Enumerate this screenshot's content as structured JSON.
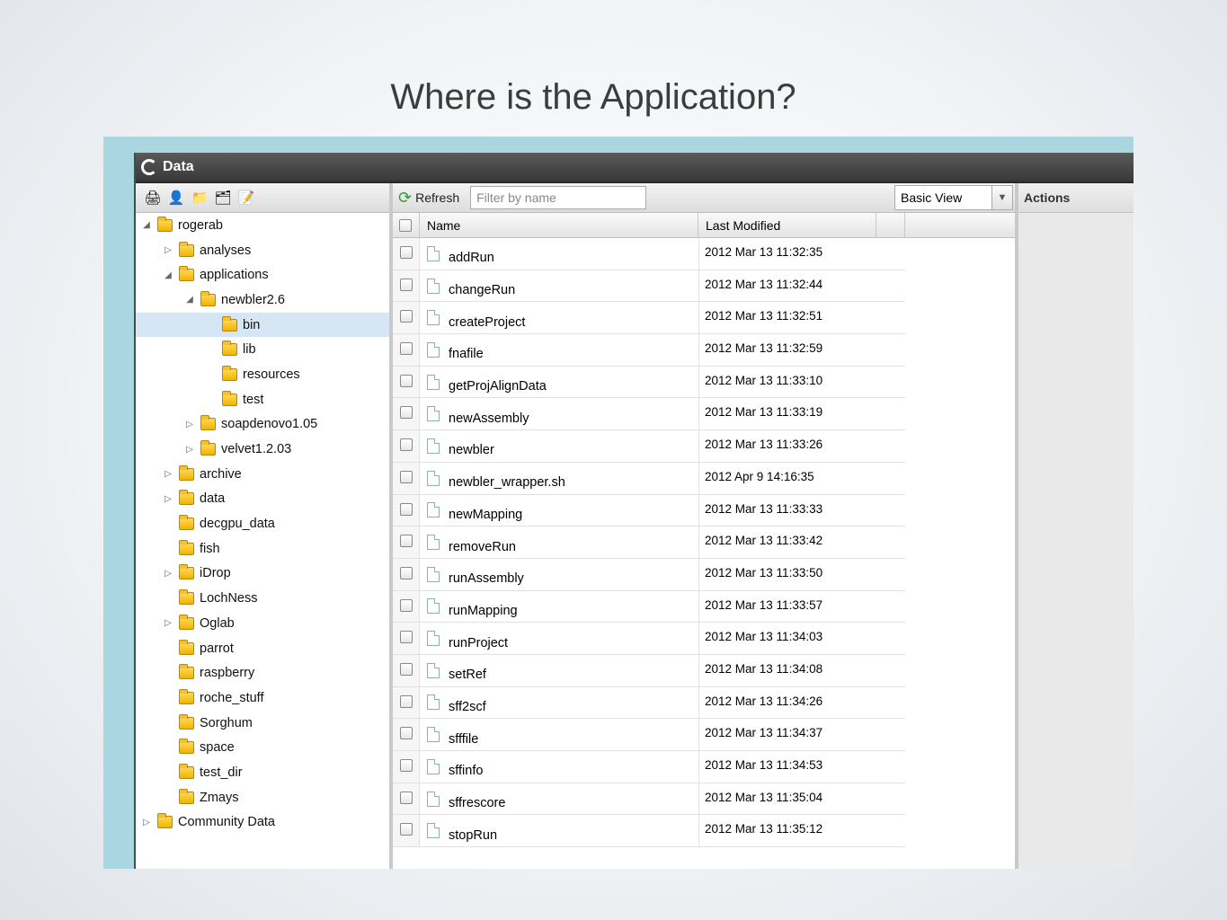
{
  "slide": {
    "title": "Where is the Application?"
  },
  "window": {
    "title": "Data"
  },
  "tree_toolbar": {
    "icons": [
      "upload-icon",
      "import-icon",
      "new-folder-icon",
      "delete-folder-icon",
      "edit-icon"
    ]
  },
  "tree": [
    {
      "label": "rogerab",
      "level": 0,
      "expander": "open"
    },
    {
      "label": "analyses",
      "level": 1,
      "expander": "closed"
    },
    {
      "label": "applications",
      "level": 1,
      "expander": "open"
    },
    {
      "label": "newbler2.6",
      "level": 2,
      "expander": "open"
    },
    {
      "label": "bin",
      "level": 3,
      "expander": "none",
      "selected": true
    },
    {
      "label": "lib",
      "level": 3,
      "expander": "none"
    },
    {
      "label": "resources",
      "level": 3,
      "expander": "none"
    },
    {
      "label": "test",
      "level": 3,
      "expander": "none"
    },
    {
      "label": "soapdenovo1.05",
      "level": 2,
      "expander": "closed"
    },
    {
      "label": "velvet1.2.03",
      "level": 2,
      "expander": "closed"
    },
    {
      "label": "archive",
      "level": 1,
      "expander": "closed"
    },
    {
      "label": "data",
      "level": 1,
      "expander": "closed"
    },
    {
      "label": "decgpu_data",
      "level": 1,
      "expander": "none"
    },
    {
      "label": "fish",
      "level": 1,
      "expander": "none"
    },
    {
      "label": "iDrop",
      "level": 1,
      "expander": "closed"
    },
    {
      "label": "LochNess",
      "level": 1,
      "expander": "none"
    },
    {
      "label": "Oglab",
      "level": 1,
      "expander": "closed"
    },
    {
      "label": "parrot",
      "level": 1,
      "expander": "none"
    },
    {
      "label": "raspberry",
      "level": 1,
      "expander": "none"
    },
    {
      "label": "roche_stuff",
      "level": 1,
      "expander": "none"
    },
    {
      "label": "Sorghum",
      "level": 1,
      "expander": "none"
    },
    {
      "label": "space",
      "level": 1,
      "expander": "none"
    },
    {
      "label": "test_dir",
      "level": 1,
      "expander": "none"
    },
    {
      "label": "Zmays",
      "level": 1,
      "expander": "none"
    },
    {
      "label": "Community Data",
      "level": 0,
      "expander": "closed"
    }
  ],
  "toolbar": {
    "refresh_label": "Refresh",
    "filter_placeholder": "Filter by name",
    "view_value": "Basic View"
  },
  "grid": {
    "columns": {
      "name": "Name",
      "modified": "Last Modified"
    },
    "rows": [
      {
        "name": "addRun",
        "modified": "2012 Mar 13 11:32:35"
      },
      {
        "name": "changeRun",
        "modified": "2012 Mar 13 11:32:44"
      },
      {
        "name": "createProject",
        "modified": "2012 Mar 13 11:32:51"
      },
      {
        "name": "fnafile",
        "modified": "2012 Mar 13 11:32:59"
      },
      {
        "name": "getProjAlignData",
        "modified": "2012 Mar 13 11:33:10"
      },
      {
        "name": "newAssembly",
        "modified": "2012 Mar 13 11:33:19"
      },
      {
        "name": "newbler",
        "modified": "2012 Mar 13 11:33:26"
      },
      {
        "name": "newbler_wrapper.sh",
        "modified": "2012 Apr 9 14:16:35"
      },
      {
        "name": "newMapping",
        "modified": "2012 Mar 13 11:33:33"
      },
      {
        "name": "removeRun",
        "modified": "2012 Mar 13 11:33:42"
      },
      {
        "name": "runAssembly",
        "modified": "2012 Mar 13 11:33:50"
      },
      {
        "name": "runMapping",
        "modified": "2012 Mar 13 11:33:57"
      },
      {
        "name": "runProject",
        "modified": "2012 Mar 13 11:34:03"
      },
      {
        "name": "setRef",
        "modified": "2012 Mar 13 11:34:08"
      },
      {
        "name": "sff2scf",
        "modified": "2012 Mar 13 11:34:26"
      },
      {
        "name": "sfffile",
        "modified": "2012 Mar 13 11:34:37"
      },
      {
        "name": "sffinfo",
        "modified": "2012 Mar 13 11:34:53"
      },
      {
        "name": "sffrescore",
        "modified": "2012 Mar 13 11:35:04"
      },
      {
        "name": "stopRun",
        "modified": "2012 Mar 13 11:35:12"
      }
    ]
  },
  "actions": {
    "title": "Actions"
  },
  "colors": {
    "background_accent": "#a9d6e0",
    "selected_row": "#d7e6f5"
  }
}
